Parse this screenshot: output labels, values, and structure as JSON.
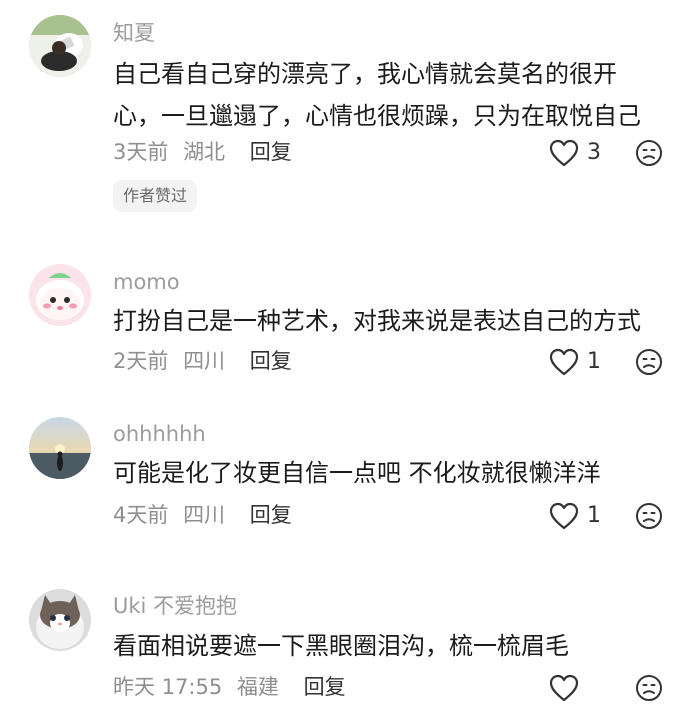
{
  "comments": [
    {
      "username": "知夏",
      "text": "自己看自己穿的漂亮了，我心情就会莫名的很开心，一旦邋遢了，心情也很烦躁，只为在取悦自己",
      "time": "3天前",
      "location": "湖北",
      "reply_label": "回复",
      "like_count": "3",
      "badge": "作者赞过"
    },
    {
      "username": "momo",
      "text": "打扮自己是一种艺术，对我来说是表达自己的方式",
      "time": "2天前",
      "location": "四川",
      "reply_label": "回复",
      "like_count": "1"
    },
    {
      "username": "ohhhhhh",
      "text": "可能是化了妆更自信一点吧 不化妆就很懒洋洋",
      "time": "4天前",
      "location": "四川",
      "reply_label": "回复",
      "like_count": "1"
    },
    {
      "username": "Uki 不爱抱抱",
      "text": "看面相说要遮一下黑眼圈泪沟，梳一梳眉毛",
      "time": "昨天 17:55",
      "location": "福建",
      "reply_label": "回复",
      "like_count": ""
    }
  ],
  "icons": {
    "like": "heart-outline-icon",
    "dislike": "frown-face-icon"
  },
  "colors": {
    "text": "#1b1b1b",
    "muted": "#9c9c9c",
    "badge_bg": "#f3f3f3"
  }
}
